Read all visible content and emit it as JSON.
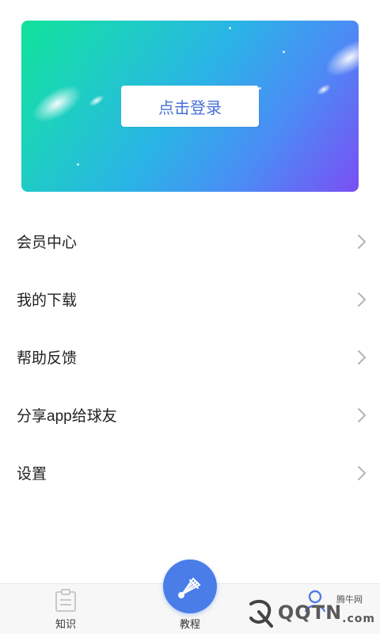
{
  "banner": {
    "login_label": "点击登录"
  },
  "menu": {
    "items": [
      {
        "label": "会员中心"
      },
      {
        "label": "我的下载"
      },
      {
        "label": "帮助反馈"
      },
      {
        "label": "分享app给球友"
      },
      {
        "label": "设置"
      }
    ]
  },
  "tabbar": {
    "tabs": [
      {
        "label": "知识",
        "icon": "book-icon"
      },
      {
        "label": "教程",
        "icon": "shuttlecock-icon"
      },
      {
        "label": "我的",
        "icon": "user-icon"
      }
    ],
    "accent": "#4a7de8"
  },
  "watermark": {
    "text": "QQTN",
    "com": ".com",
    "site_label": "腾牛网"
  },
  "colors": {
    "banner_gradient_start": "#10e29a",
    "banner_gradient_end": "#7a4ff4",
    "login_text": "#4a6fd8"
  }
}
